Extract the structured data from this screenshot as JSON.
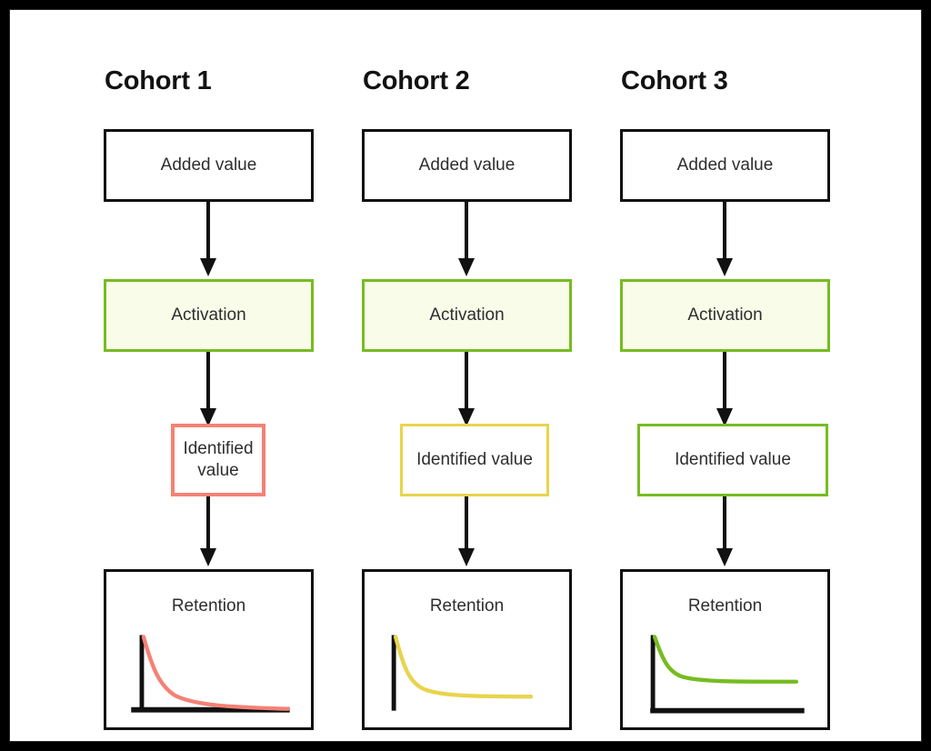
{
  "diagram": {
    "title_row": [
      {
        "label": "Cohort 1"
      },
      {
        "label": "Cohort 2"
      },
      {
        "label": "Cohort 3"
      }
    ],
    "columns": [
      {
        "name": "cohort-1",
        "title": "Cohort 1",
        "accent": "#f58175",
        "steps": [
          {
            "id": "added-value",
            "label": "Added value",
            "style": "plain"
          },
          {
            "id": "activation",
            "label": "Activation",
            "style": "act"
          },
          {
            "id": "identified-value",
            "label": "Identified value",
            "style": "red"
          },
          {
            "id": "retention",
            "label": "Retention",
            "style": "plain"
          }
        ]
      },
      {
        "name": "cohort-2",
        "title": "Cohort 2",
        "accent": "#e8d44d",
        "steps": [
          {
            "id": "added-value",
            "label": "Added value",
            "style": "plain"
          },
          {
            "id": "activation",
            "label": "Activation",
            "style": "act"
          },
          {
            "id": "identified-value",
            "label": "Identified value",
            "style": "yellow"
          },
          {
            "id": "retention",
            "label": "Retention",
            "style": "plain"
          }
        ]
      },
      {
        "name": "cohort-3",
        "title": "Cohort 3",
        "accent": "#76bc21",
        "steps": [
          {
            "id": "added-value",
            "label": "Added value",
            "style": "plain"
          },
          {
            "id": "activation",
            "label": "Activation",
            "style": "act"
          },
          {
            "id": "identified-value",
            "label": "Identified value",
            "style": "green"
          },
          {
            "id": "retention",
            "label": "Retention",
            "style": "plain"
          }
        ]
      }
    ],
    "colors": {
      "frame": "#000000",
      "canvas": "#ffffff",
      "outline": "#111111",
      "green": "#76bc21",
      "green_fill": "#f8fce9",
      "red": "#f58175",
      "yellow": "#e8d44d",
      "text": "#2e2e2e",
      "heading": "#121212",
      "arrow": "#111111"
    }
  },
  "chart_data": [
    {
      "type": "line",
      "name": "cohort-1-retention",
      "title": "Retention",
      "xlabel": "",
      "ylabel": "",
      "xlim": [
        0,
        100
      ],
      "ylim": [
        0,
        100
      ],
      "grid": false,
      "legend": "none",
      "color": "#f58175",
      "axes": {
        "y_axis": true,
        "x_axis": true
      },
      "x": [
        0,
        3,
        6,
        10,
        16,
        24,
        34,
        46,
        60,
        78,
        100
      ],
      "y": [
        100,
        72,
        55,
        41,
        29,
        20,
        14,
        10,
        7,
        4,
        1
      ]
    },
    {
      "type": "line",
      "name": "cohort-2-retention",
      "title": "Retention",
      "xlabel": "",
      "ylabel": "",
      "xlim": [
        0,
        100
      ],
      "ylim": [
        0,
        100
      ],
      "grid": false,
      "legend": "none",
      "color": "#e8d44d",
      "axes": {
        "y_axis": true,
        "x_axis": false
      },
      "x": [
        0,
        3,
        7,
        12,
        18,
        26,
        36,
        50,
        65,
        82,
        100
      ],
      "y": [
        100,
        70,
        50,
        36,
        27,
        22,
        20,
        19,
        19,
        19,
        19
      ]
    },
    {
      "type": "line",
      "name": "cohort-3-retention",
      "title": "Retention",
      "xlabel": "",
      "ylabel": "",
      "xlim": [
        0,
        100
      ],
      "ylim": [
        0,
        100
      ],
      "grid": false,
      "legend": "none",
      "color": "#76bc21",
      "axes": {
        "y_axis": true,
        "x_axis": true
      },
      "x": [
        0,
        3,
        7,
        12,
        18,
        26,
        36,
        50,
        65,
        82,
        100
      ],
      "y": [
        100,
        76,
        60,
        50,
        45,
        43,
        42,
        42,
        42,
        42,
        42
      ]
    }
  ]
}
